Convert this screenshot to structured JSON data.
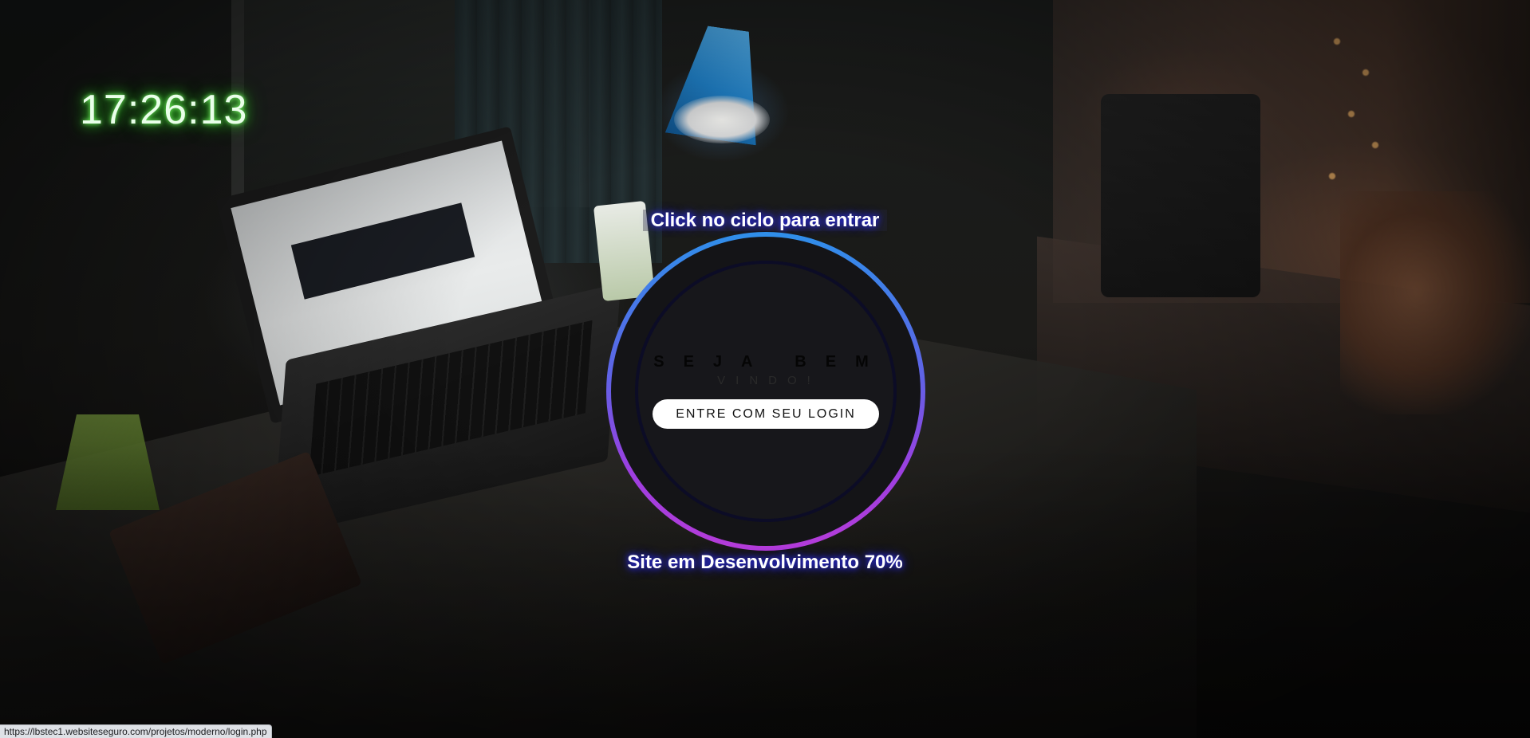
{
  "clock": {
    "time": "17:26:13"
  },
  "entry": {
    "hint": "Click no ciclo para entrar",
    "welcome_line1": "SEJA BEM",
    "welcome_line2": "VINDO!",
    "login_button": "ENTRE COM SEU LOGIN"
  },
  "status": {
    "development": "Site em Desenvolvimento 70%",
    "progress_percent": 70
  },
  "browser": {
    "status_bar_url": "https://lbstec1.websiteseguro.com/projetos/moderno/login.php"
  },
  "colors": {
    "clock_glow": "#38d62a",
    "ring_top": "#2f8fea",
    "ring_bottom": "#b53cd9",
    "text_glow": "#3030ff"
  },
  "icons": {
    "background": "desk-photo"
  }
}
